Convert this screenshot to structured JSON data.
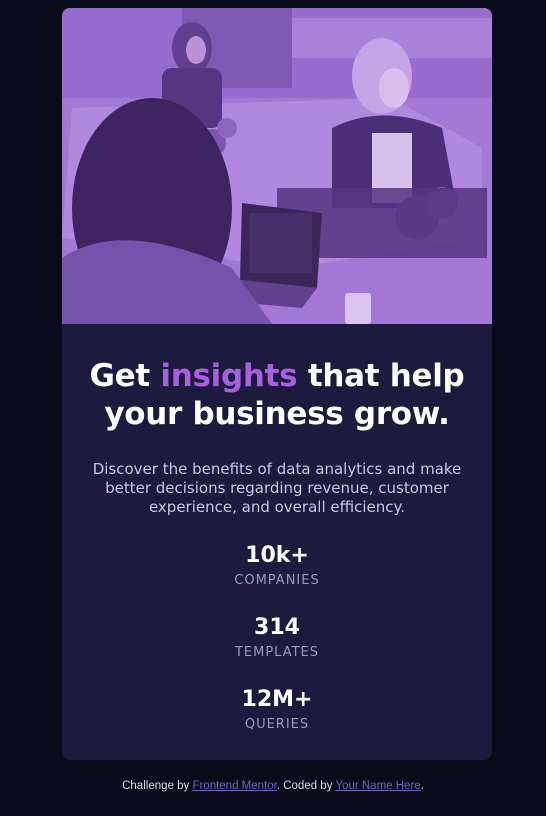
{
  "card": {
    "image_alt": "Team working in an office",
    "headline": {
      "before": "Get ",
      "accent": "insights",
      "after": " that help your business grow."
    },
    "description": "Discover the benefits of data analytics and make better decisions regarding revenue, customer experience, and overall efficiency.",
    "stats": [
      {
        "value": "10k+",
        "label": "COMPANIES"
      },
      {
        "value": "314",
        "label": "TEMPLATES"
      },
      {
        "value": "12M+",
        "label": "QUERIES"
      }
    ]
  },
  "attribution": {
    "prefix": "Challenge by ",
    "link1": "Frontend Mentor",
    "middle": ". Coded by ",
    "link2": "Your Name Here",
    "suffix": "."
  },
  "colors": {
    "page_bg": "#090b1a",
    "card_bg": "#1c1a3d",
    "accent": "#a860e0",
    "image_tint": "#9a6dd0"
  }
}
